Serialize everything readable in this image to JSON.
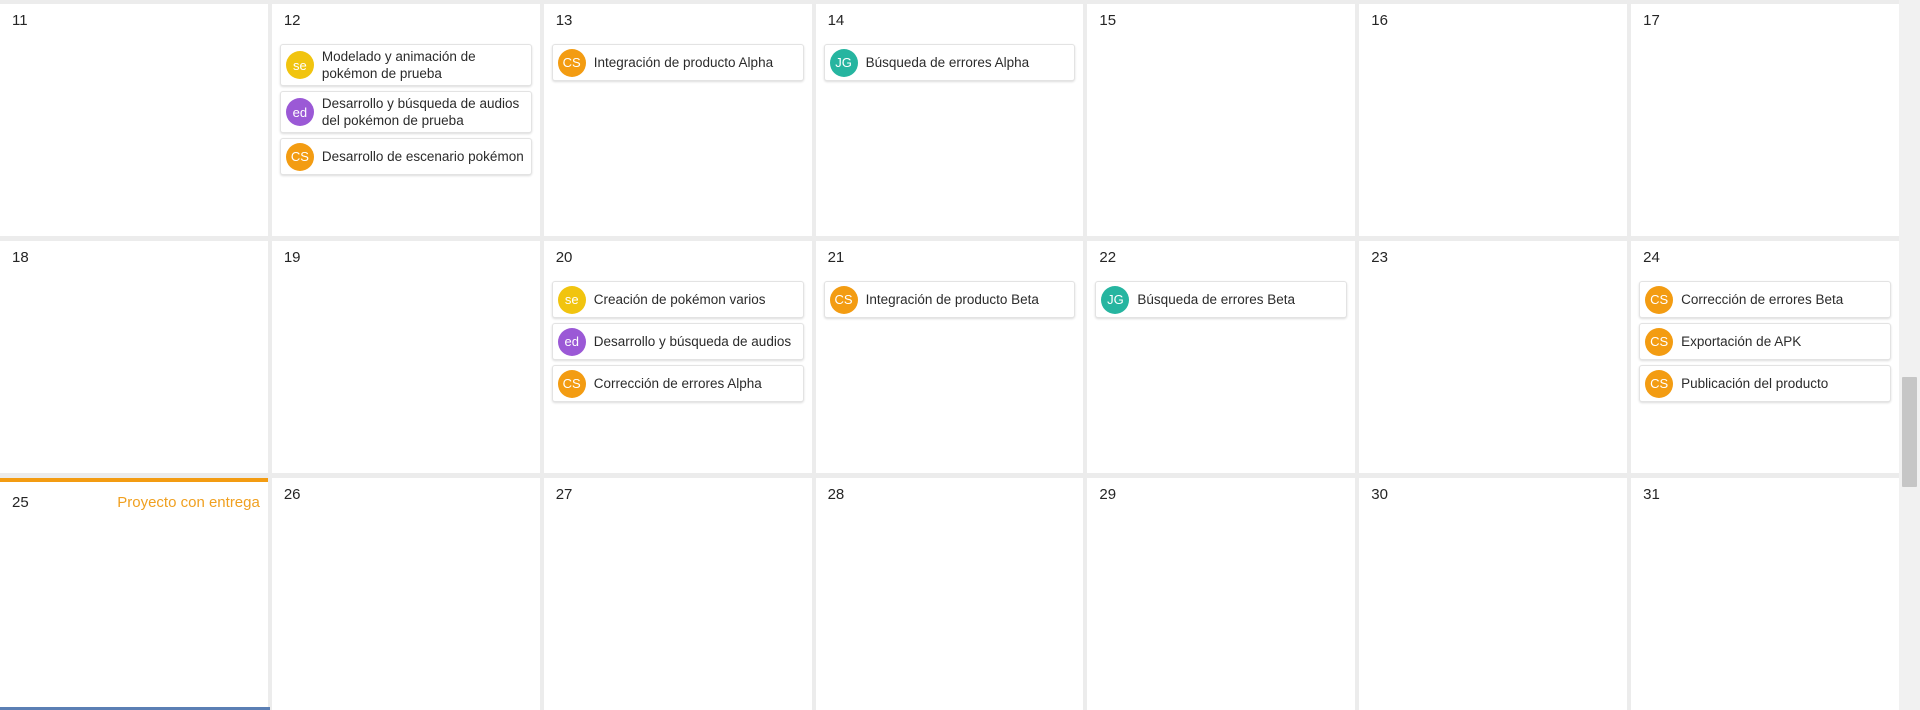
{
  "colors": {
    "accent_orange": "#f39c12",
    "avatar_se": "#f1c40f",
    "avatar_ed": "#9b59d6",
    "avatar_cs": "#f39c12",
    "avatar_jg": "#26b5a0"
  },
  "weeks": [
    {
      "days": [
        {
          "num": "11",
          "note": "",
          "tasks": []
        },
        {
          "num": "12",
          "note": "",
          "tasks": [
            {
              "avatar": "se",
              "avatar_color": "#f1c40f",
              "text": "Modelado y animación de pokémon de prueba"
            },
            {
              "avatar": "ed",
              "avatar_color": "#9b59d6",
              "text": "Desarrollo y búsqueda de audios del pokémon de prueba"
            },
            {
              "avatar": "CS",
              "avatar_color": "#f39c12",
              "text": "Desarrollo de escenario pokémon"
            }
          ]
        },
        {
          "num": "13",
          "note": "",
          "tasks": [
            {
              "avatar": "CS",
              "avatar_color": "#f39c12",
              "text": "Integración de producto Alpha"
            }
          ]
        },
        {
          "num": "14",
          "note": "",
          "tasks": [
            {
              "avatar": "JG",
              "avatar_color": "#26b5a0",
              "text": "Búsqueda de errores Alpha"
            }
          ]
        },
        {
          "num": "15",
          "note": "",
          "tasks": []
        },
        {
          "num": "16",
          "note": "",
          "tasks": []
        },
        {
          "num": "17",
          "note": "",
          "tasks": []
        }
      ]
    },
    {
      "days": [
        {
          "num": "18",
          "note": "",
          "tasks": []
        },
        {
          "num": "19",
          "note": "",
          "tasks": []
        },
        {
          "num": "20",
          "note": "",
          "tasks": [
            {
              "avatar": "se",
              "avatar_color": "#f1c40f",
              "text": "Creación de pokémon varios"
            },
            {
              "avatar": "ed",
              "avatar_color": "#9b59d6",
              "text": "Desarrollo y búsqueda de audios"
            },
            {
              "avatar": "CS",
              "avatar_color": "#f39c12",
              "text": "Corrección de errores Alpha"
            }
          ]
        },
        {
          "num": "21",
          "note": "",
          "tasks": [
            {
              "avatar": "CS",
              "avatar_color": "#f39c12",
              "text": "Integración de producto Beta"
            }
          ]
        },
        {
          "num": "22",
          "note": "",
          "tasks": [
            {
              "avatar": "JG",
              "avatar_color": "#26b5a0",
              "text": "Búsqueda de errores Beta"
            }
          ]
        },
        {
          "num": "23",
          "note": "",
          "tasks": []
        },
        {
          "num": "24",
          "note": "",
          "tasks": [
            {
              "avatar": "CS",
              "avatar_color": "#f39c12",
              "text": "Corrección de errores Beta"
            },
            {
              "avatar": "CS",
              "avatar_color": "#f39c12",
              "text": "Exportación de APK"
            },
            {
              "avatar": "CS",
              "avatar_color": "#f39c12",
              "text": "Publicación del producto"
            }
          ]
        }
      ]
    },
    {
      "days": [
        {
          "num": "25",
          "note": "Proyecto con entrega",
          "today": true,
          "tasks": []
        },
        {
          "num": "26",
          "note": "",
          "tasks": []
        },
        {
          "num": "27",
          "note": "",
          "tasks": []
        },
        {
          "num": "28",
          "note": "",
          "tasks": []
        },
        {
          "num": "29",
          "note": "",
          "tasks": []
        },
        {
          "num": "30",
          "note": "",
          "tasks": []
        },
        {
          "num": "31",
          "note": "",
          "tasks": []
        }
      ]
    }
  ]
}
